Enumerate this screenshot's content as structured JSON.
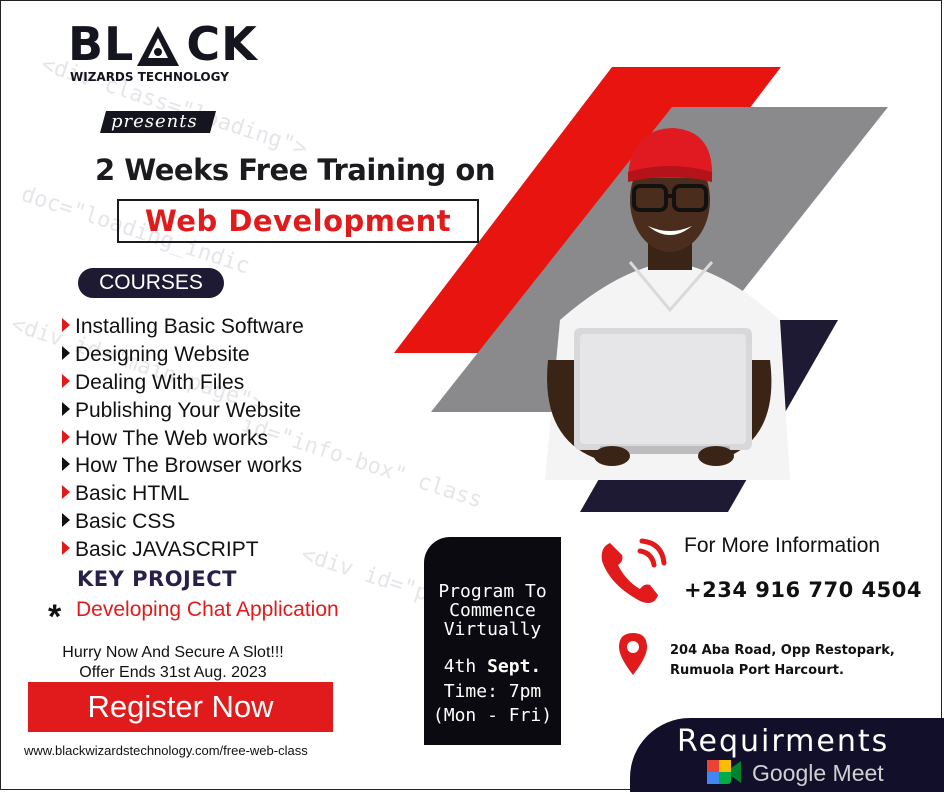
{
  "brand": {
    "logo_left": "BL",
    "logo_right": "CK",
    "subtitle": "WIZARDS TECHNOLOGY"
  },
  "presents": "presents",
  "headline": "2 Weeks Free Training on",
  "course_title": "Web Development",
  "courses_label": "COURSES",
  "courses": [
    {
      "label": "Installing Basic Software",
      "bullet": "red"
    },
    {
      "label": "Designing Website",
      "bullet": "dark"
    },
    {
      "label": "Dealing With Files",
      "bullet": "red"
    },
    {
      "label": "Publishing Your Website",
      "bullet": "dark"
    },
    {
      "label": "How The Web works",
      "bullet": "red"
    },
    {
      "label": "How The Browser works",
      "bullet": "dark"
    },
    {
      "label": "Basic HTML",
      "bullet": "red"
    },
    {
      "label": "Basic CSS",
      "bullet": "dark"
    },
    {
      "label": "Basic JAVASCRIPT",
      "bullet": "red"
    }
  ],
  "key_project": {
    "heading": "KEY PROJECT",
    "star": "*",
    "item": "Developing Chat Application"
  },
  "hurry": {
    "line1": "Hurry Now And Secure A Slot!!!",
    "line2": "Offer Ends 31st Aug. 2023"
  },
  "register_label": "Register Now",
  "url": "www.blackwizardstechnology.com/free-web-class",
  "program": {
    "line1": "Program To",
    "line2": "Commence",
    "line3": "Virtually",
    "date_prefix": "4th",
    "date_month": "Sept.",
    "time": "Time: 7pm",
    "days": "(Mon - Fri)"
  },
  "contact": {
    "more_info": "For More Information",
    "phone": "+234 916 770 4504",
    "address_line1": "204 Aba Road, Opp Restopark,",
    "address_line2": "Rumuola Port Harcourt."
  },
  "requirements": {
    "label": "Requirments",
    "tool": "Google Meet"
  },
  "colors": {
    "accent_red": "#e11b1b",
    "navy": "#1f1a33",
    "black_panel": "#0a0a10",
    "gray_panel": "#8a8a8c"
  },
  "icons": [
    "wizard-icon",
    "triangle-bullet-icon",
    "phone-icon",
    "location-pin-icon",
    "google-meet-icon"
  ]
}
